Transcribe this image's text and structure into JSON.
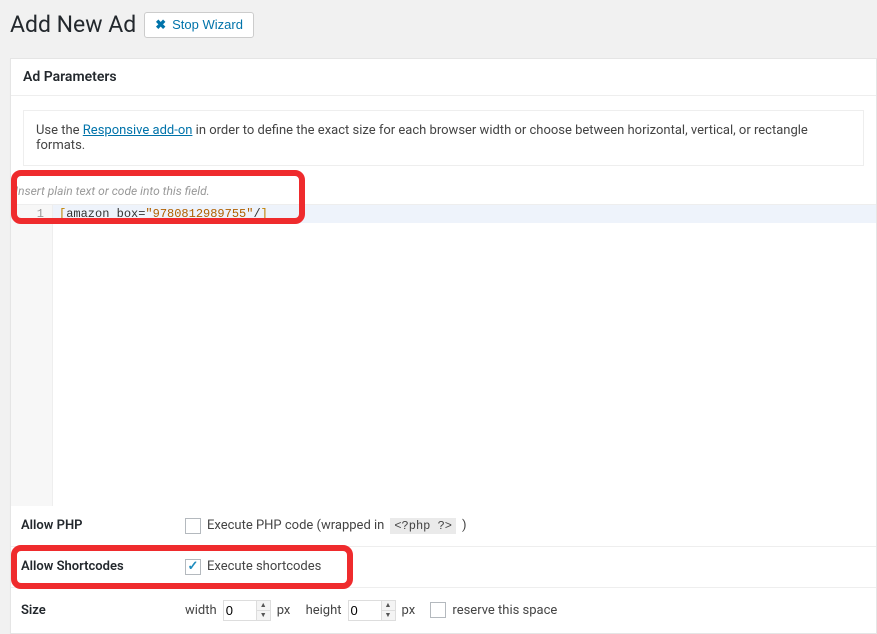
{
  "header": {
    "title": "Add New Ad",
    "stop_wizard_label": "Stop Wizard"
  },
  "panel": {
    "title": "Ad Parameters",
    "notice_prefix": "Use the ",
    "notice_link": "Responsive add-on",
    "notice_suffix": " in order to define the exact size for each browser width or choose between horizontal, vertical, or rectangle formats.",
    "code_hint": "Insert plain text or code into this field.",
    "code_line_number": "1",
    "code_open": "[",
    "code_tag": "amazon box=",
    "code_value": "\"9780812989755\"",
    "code_slash": "/",
    "code_close": "]"
  },
  "allow_php": {
    "label": "Allow PHP",
    "checkbox_checked": false,
    "text_before": "Execute PHP code (wrapped in ",
    "code": "<?php ?>",
    "text_after": " )"
  },
  "allow_shortcodes": {
    "label": "Allow Shortcodes",
    "checkbox_checked": true,
    "text": "Execute shortcodes"
  },
  "size": {
    "label": "Size",
    "width_label": "width",
    "width_value": "0",
    "px": "px",
    "height_label": "height",
    "height_value": "0",
    "reserve_checked": false,
    "reserve_label": "reserve this space"
  }
}
